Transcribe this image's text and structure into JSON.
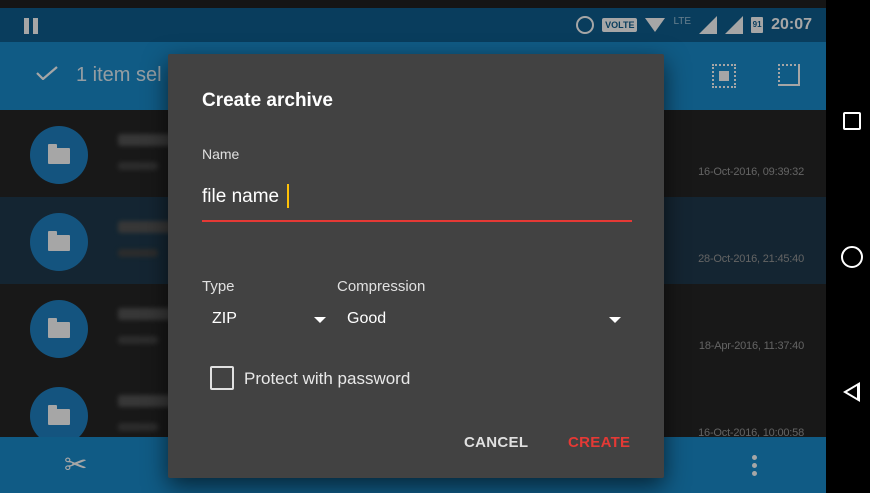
{
  "status_bar": {
    "volte_label": "VOLTE",
    "lte_label": "LTE",
    "battery_label": "91",
    "time": "20:07"
  },
  "app_bar": {
    "title": "1 item sel"
  },
  "file_list": [
    {
      "date": "16-Oct-2016, 09:39:32",
      "selected": false
    },
    {
      "date": "28-Oct-2016, 21:45:40",
      "selected": true
    },
    {
      "date": "18-Apr-2016, 11:37:40",
      "selected": false
    },
    {
      "date": "16-Oct-2016, 10:00:58",
      "selected": false
    }
  ],
  "dialog": {
    "title": "Create archive",
    "name_label": "Name",
    "name_value": "file name",
    "type_label": "Type",
    "type_value": "ZIP",
    "compression_label": "Compression",
    "compression_value": "Good",
    "password_label": "Protect with password",
    "password_checked": false,
    "cancel_label": "CANCEL",
    "create_label": "CREATE"
  },
  "colors": {
    "status_bar": "#0f5f8f",
    "app_bar": "#1a8ccd",
    "folder_circle": "#1f82c4",
    "accent": "#e53935",
    "dialog_bg": "#424242"
  },
  "icons": {
    "status": [
      "pause-icon",
      "alarm-icon",
      "wifi-icon",
      "signal-icon",
      "battery-icon"
    ],
    "app_bar": [
      "check-icon",
      "select-all-icon",
      "select-inverse-icon"
    ],
    "bottom_bar": [
      "cut-icon",
      "more-icon"
    ],
    "nav": [
      "nav-recent-icon",
      "nav-home-icon",
      "nav-back-icon"
    ]
  }
}
